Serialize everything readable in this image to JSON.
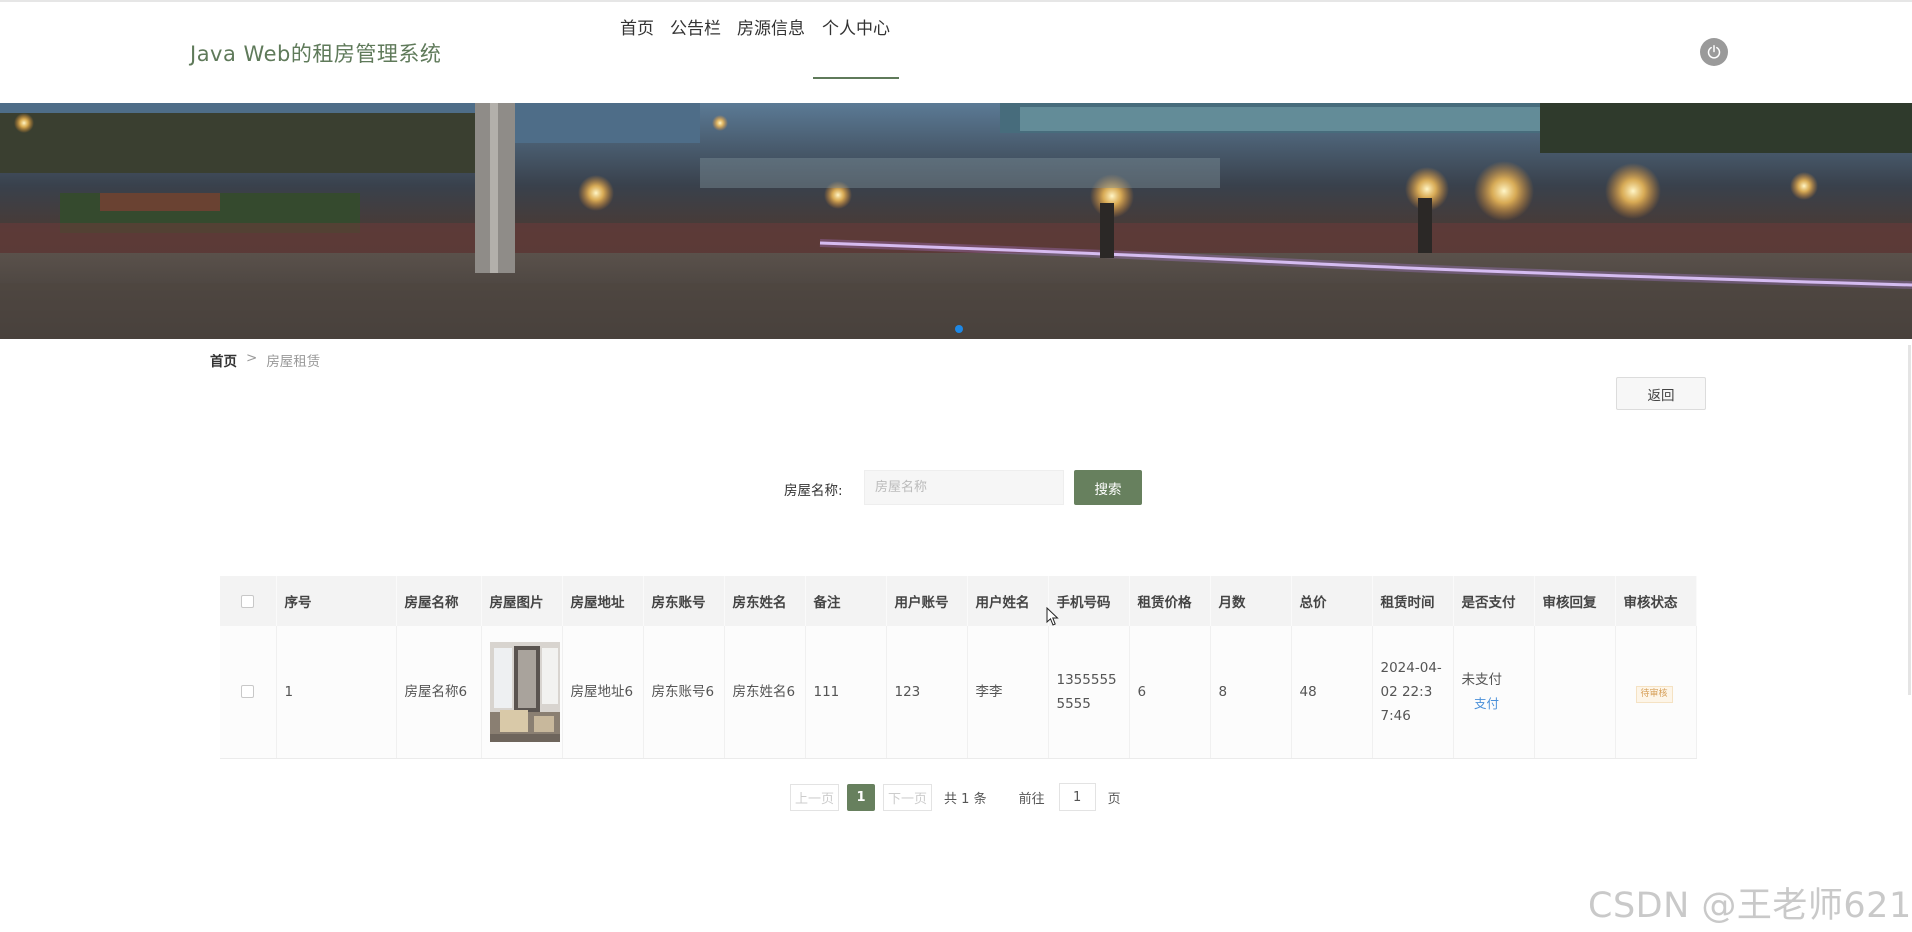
{
  "header": {
    "site_title": "Java Web的租房管理系统",
    "nav": [
      {
        "label": "首页",
        "active": false
      },
      {
        "label": "公告栏",
        "active": false
      },
      {
        "label": "房源信息",
        "active": false
      },
      {
        "label": "个人中心",
        "active": true
      }
    ],
    "power_icon": "power-icon"
  },
  "breadcrumb": {
    "home": "首页",
    "separator": ">",
    "current": "房屋租赁"
  },
  "actions": {
    "back_label": "返回"
  },
  "search": {
    "label": "房屋名称:",
    "placeholder": "房屋名称",
    "button_label": "搜索"
  },
  "table": {
    "headers": [
      "序号",
      "房屋名称",
      "房屋图片",
      "房屋地址",
      "房东账号",
      "房东姓名",
      "备注",
      "用户账号",
      "用户姓名",
      "手机号码",
      "租赁价格",
      "月数",
      "总价",
      "租赁时间",
      "是否支付",
      "审核回复",
      "审核状态"
    ],
    "rows": [
      {
        "index": "1",
        "house_name": "房屋名称6",
        "house_address": "房屋地址6",
        "landlord_account": "房东账号6",
        "landlord_name": "房东姓名6",
        "remark": "111",
        "user_account": "123",
        "user_name": "李李",
        "phone": "13555555555",
        "rent_price": "6",
        "months": "8",
        "total": "48",
        "rent_time": "2024-04-02 22:37:46",
        "paid_status": "未支付",
        "pay_link": "支付",
        "review_reply": "",
        "review_status": "待审核"
      }
    ]
  },
  "pager": {
    "prev": "上一页",
    "current_page": "1",
    "next": "下一页",
    "total": "共 1 条",
    "goto_label": "前往",
    "goto_value": "1",
    "page_suffix": "页"
  },
  "watermark": "CSDN @王老师621",
  "colors": {
    "accent": "#67805e",
    "title": "#5f7a5a",
    "link": "#4a90d9",
    "carousel_dot": "#1e88e5"
  }
}
